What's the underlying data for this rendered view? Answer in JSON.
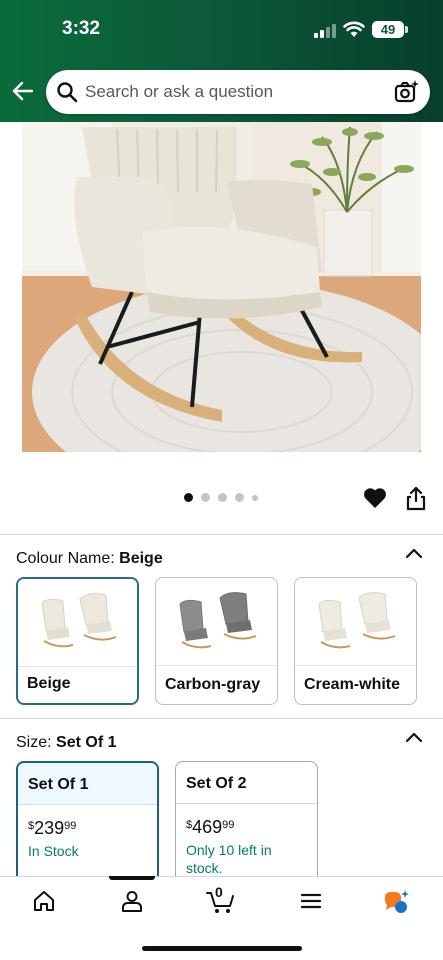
{
  "status_bar": {
    "time": "3:32",
    "battery": "49"
  },
  "search": {
    "placeholder": "Search or ask a question"
  },
  "image_carousel": {
    "dot_count": 5,
    "active_index": 0
  },
  "colour": {
    "label": "Colour Name:",
    "selected": "Beige",
    "options": [
      {
        "label": "Beige",
        "selected": true
      },
      {
        "label": "Carbon-gray",
        "selected": false
      },
      {
        "label": "Cream-white",
        "selected": false
      }
    ]
  },
  "size": {
    "label": "Size:",
    "selected": "Set Of 1",
    "options": [
      {
        "label": "Set Of 1",
        "currency": "$",
        "price_whole": "239",
        "price_cents": "99",
        "availability": "In Stock",
        "selected": true
      },
      {
        "label": "Set Of 2",
        "currency": "$",
        "price_whole": "469",
        "price_cents": "99",
        "availability": "Only 10 left in stock.",
        "selected": false
      }
    ]
  },
  "bottom_nav": {
    "cart_count": "0"
  },
  "colors": {
    "header_green": "#0d5a3a",
    "selected_border": "#2a6a8c",
    "stock_green": "#067d62"
  }
}
